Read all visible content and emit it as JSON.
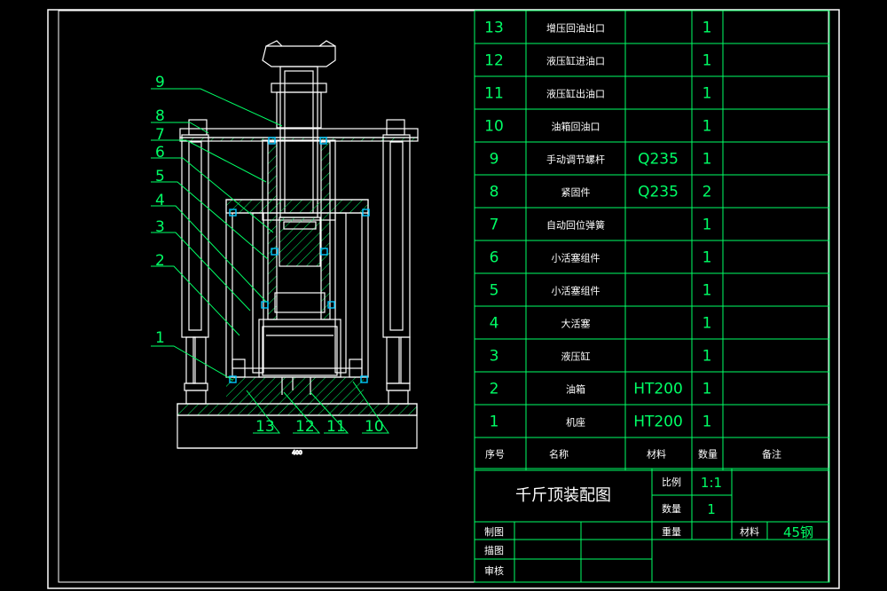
{
  "drawing": {
    "title": "千斤顶装配图",
    "dimension_label": "400"
  },
  "callouts": [
    {
      "n": "9"
    },
    {
      "n": "8"
    },
    {
      "n": "7"
    },
    {
      "n": "6"
    },
    {
      "n": "5"
    },
    {
      "n": "4"
    },
    {
      "n": "3"
    },
    {
      "n": "2"
    },
    {
      "n": "1"
    },
    {
      "n": "13"
    },
    {
      "n": "12"
    },
    {
      "n": "11"
    },
    {
      "n": "10"
    }
  ],
  "bom": {
    "rows": [
      {
        "no": "13",
        "name": "增压回油出口",
        "material": "",
        "qty": "1"
      },
      {
        "no": "12",
        "name": "液压缸进油口",
        "material": "",
        "qty": "1"
      },
      {
        "no": "11",
        "name": "液压缸出油口",
        "material": "",
        "qty": "1"
      },
      {
        "no": "10",
        "name": "油箱回油口",
        "material": "",
        "qty": "1"
      },
      {
        "no": "9",
        "name": "手动调节螺杆",
        "material": "Q235",
        "qty": "1"
      },
      {
        "no": "8",
        "name": "紧固件",
        "material": "Q235",
        "qty": "2"
      },
      {
        "no": "7",
        "name": "自动回位弹簧",
        "material": "",
        "qty": "1"
      },
      {
        "no": "6",
        "name": "小活塞组件",
        "material": "",
        "qty": "1"
      },
      {
        "no": "5",
        "name": "小活塞组件",
        "material": "",
        "qty": "1"
      },
      {
        "no": "4",
        "name": "大活塞",
        "material": "",
        "qty": "1"
      },
      {
        "no": "3",
        "name": "液压缸",
        "material": "",
        "qty": "1"
      },
      {
        "no": "2",
        "name": "油箱",
        "material": "HT200",
        "qty": "1"
      },
      {
        "no": "1",
        "name": "机座",
        "material": "HT200",
        "qty": "1"
      }
    ],
    "header": {
      "no": "序号",
      "name": "名称",
      "material": "材料",
      "qty": "数量",
      "remark": "备注"
    }
  },
  "title_block": {
    "scale_label": "比例",
    "scale_value": "1:1",
    "qty_label": "数量",
    "qty_value": "1",
    "weight_label": "重量",
    "material_label": "材料",
    "material_value": "45钢",
    "drawn_label": "制图",
    "traced_label": "描图",
    "checked_label": "审核"
  },
  "colors": {
    "border": "#ffffff",
    "table": "#00ff66",
    "geometry": "#ffffff",
    "seal": "#00c8ff",
    "hatch": "#00ff66"
  }
}
